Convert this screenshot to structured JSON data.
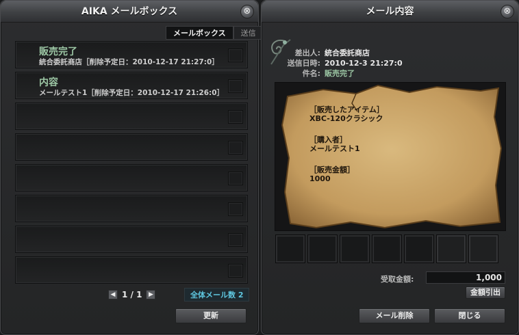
{
  "left": {
    "title": "AIKA メールボックス",
    "close": "⊗",
    "tabs": [
      {
        "label": "メールボックス",
        "active": true
      },
      {
        "label": "送信",
        "active": false
      }
    ],
    "mails": [
      {
        "subject": "販売完了",
        "meta": "統合委託商店［削除予定日：2010-12-17 21:27:0］"
      },
      {
        "subject": "内容",
        "meta": "メールテスト1［削除予定日：2010-12-17 21:26:0］"
      },
      {
        "subject": "",
        "meta": ""
      },
      {
        "subject": "",
        "meta": ""
      },
      {
        "subject": "",
        "meta": ""
      },
      {
        "subject": "",
        "meta": ""
      },
      {
        "subject": "",
        "meta": ""
      },
      {
        "subject": "",
        "meta": ""
      }
    ],
    "pager": {
      "prev": "◀",
      "text": "1 / 1",
      "next": "▶"
    },
    "total_mail": "全体メール数 2",
    "refresh_button": "更新"
  },
  "right": {
    "title": "メール内容",
    "close": "⊗",
    "sender_label": "差出人:",
    "sender": "統合委託商店",
    "sent_label": "送信日時:",
    "sent": "2010-12-3 21:27:0",
    "subject_label": "件名:",
    "subject": "販売完了",
    "body": {
      "item_header": "［販売したアイテム］",
      "item_value": "XBC-120クラシック",
      "buyer_header": "［購入者］",
      "buyer_value": "メールテスト1",
      "amount_header": "［販売金額］",
      "amount_value": "1000"
    },
    "received_label": "受取金額:",
    "received_value": "1,000",
    "withdraw_button": "金額引出",
    "delete_button": "メール削除",
    "close_button": "閉じる"
  },
  "colors": {
    "subject_green": "#9cc6a4",
    "total_mail_blue": "#5fc7e0",
    "parchment": "#c9a56a"
  }
}
